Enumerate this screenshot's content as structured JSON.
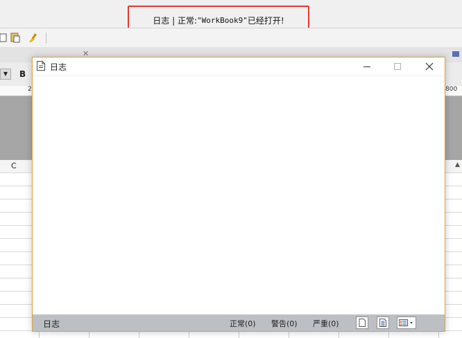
{
  "status_message": {
    "prefix": "日志 | 正常:",
    "quote_open": "\"",
    "workbook": "WorkBook9",
    "quote_close": "\"",
    "suffix": "已经打开!"
  },
  "background": {
    "format_bold_label": "B",
    "column_c_label": "C",
    "ruler_left_tick": "2",
    "ruler_right_tick": "800"
  },
  "log_window": {
    "title": "日志",
    "statusbar": {
      "label": "日志",
      "normal_count": "正常(0)",
      "warning_count": "警告(0)",
      "severe_count": "严重(0)"
    }
  },
  "colors": {
    "highlight_border": "#e23a2e",
    "window_border": "#e0a040",
    "statusbar_bg": "#bcbfc4"
  }
}
